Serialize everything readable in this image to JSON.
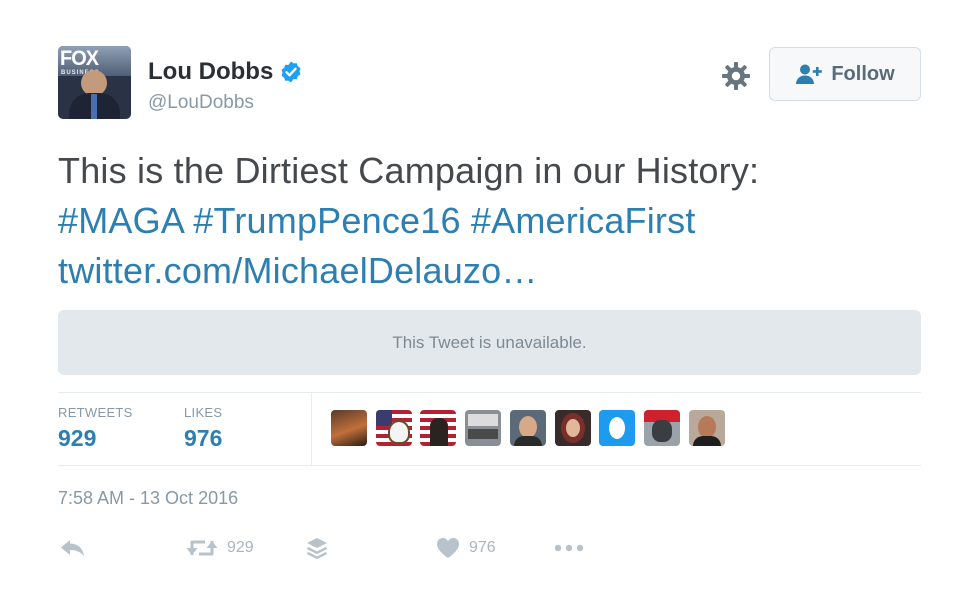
{
  "author": {
    "name": "Lou Dobbs",
    "handle": "@LouDobbs",
    "avatar_logo": "FOX",
    "avatar_logo_sub": "BUSINESS",
    "verified": true
  },
  "header": {
    "follow_label": "Follow"
  },
  "tweet": {
    "text_line1": "This is the Dirtiest Campaign in our History:",
    "hashtags": [
      "#MAGA",
      "#TrumpPence16",
      "#AmericaFirst"
    ],
    "link": "twitter.com/MichaelDelauzo…",
    "quoted_notice": "This Tweet is unavailable."
  },
  "stats": {
    "retweets_label": "RETWEETS",
    "retweets_value": "929",
    "likes_label": "LIKES",
    "likes_value": "976"
  },
  "timestamp": "7:58 AM - 13 Oct 2016",
  "actions": {
    "retweet_count": "929",
    "like_count": "976"
  },
  "colors": {
    "link": "#2c7fb0",
    "verified": "#1da1f2",
    "muted": "#8899a6"
  },
  "likers": [
    {
      "name": "liker-avatar-1"
    },
    {
      "name": "liker-avatar-2"
    },
    {
      "name": "liker-avatar-3"
    },
    {
      "name": "liker-avatar-4"
    },
    {
      "name": "liker-avatar-5"
    },
    {
      "name": "liker-avatar-6"
    },
    {
      "name": "liker-avatar-7"
    },
    {
      "name": "liker-avatar-8"
    },
    {
      "name": "liker-avatar-9"
    }
  ]
}
